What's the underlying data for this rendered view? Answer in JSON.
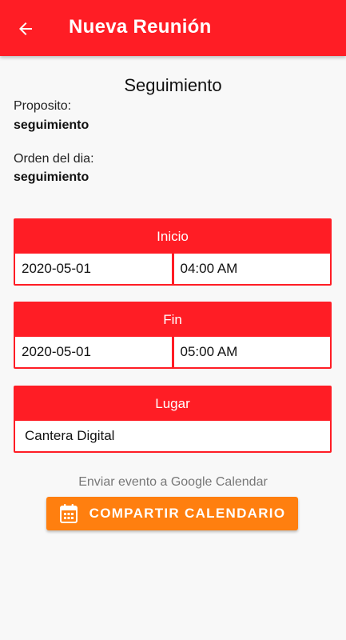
{
  "app_bar": {
    "title": "Nueva Reunión",
    "back_icon": "arrow-back-icon",
    "color": "#ff1d25"
  },
  "meeting": {
    "title": "Seguimiento",
    "purpose_label": "Proposito:",
    "purpose_value": "seguimiento",
    "agenda_label": "Orden del dia:",
    "agenda_value": "seguimiento"
  },
  "start": {
    "header": "Inicio",
    "date": "2020-05-01",
    "time": "04:00 AM"
  },
  "end": {
    "header": "Fin",
    "date": "2020-05-01",
    "time": "05:00 AM"
  },
  "place": {
    "header": "Lugar",
    "value": "Cantera Digital"
  },
  "share": {
    "hint": "Enviar evento a Google Calendar",
    "button_label": "COMPARTIR CALENDARIO",
    "icon": "calendar-icon",
    "color": "#ff7f0f"
  }
}
